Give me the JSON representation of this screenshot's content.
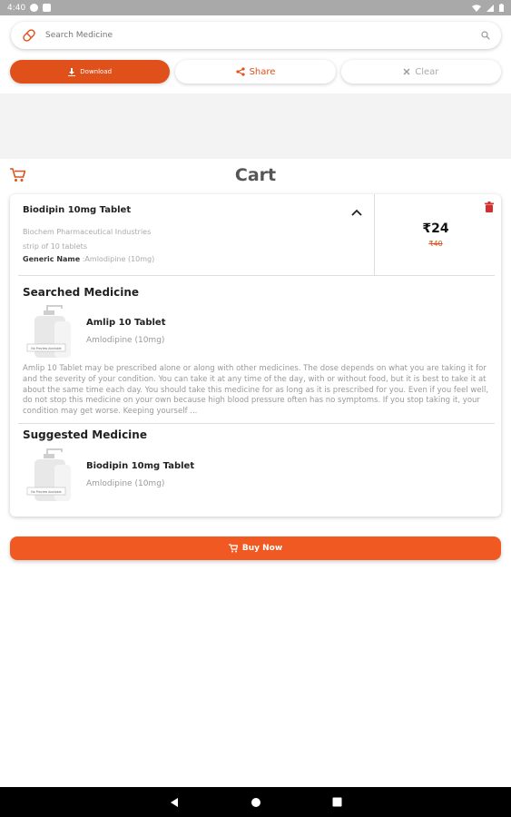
{
  "status": {
    "time": "4:40"
  },
  "search": {
    "placeholder": "Search Medicine"
  },
  "actions": {
    "download": "Download",
    "share": "Share",
    "clear": "Clear"
  },
  "cart": {
    "title": "Cart",
    "item": {
      "name": "Biodipin 10mg Tablet",
      "manufacturer": "Biochem Pharmaceutical Industries",
      "pack": "strip of 10 tablets",
      "generic_label": "Generic Name",
      "generic_value": ":Amlodipine (10mg)",
      "price": "₹24",
      "mrp": "₹40"
    },
    "searched": {
      "title": "Searched Medicine",
      "name": "Amlip 10 Tablet",
      "generic": "Amlodipine (10mg)",
      "thumb_label": "No Preview Available",
      "description": "Amlip 10 Tablet may be prescribed alone or along with other medicines. The dose depends on what you are taking it for and the severity of your condition. You can take it at any time of the day, with or without food, but it is best to take it at about the same time each day. You should take this medicine for as long as it is prescribed for you. Even if you feel well, do not stop this medicine on your own because high blood pressure often has no symptoms. If you stop taking it, your condition may get worse. Keeping yourself ..."
    },
    "suggested": {
      "title": "Suggested Medicine",
      "name": "Biodipin 10mg Tablet",
      "generic": "Amlodipine (10mg)",
      "thumb_label": "No Preview Available"
    },
    "buy_now": "Buy Now"
  },
  "colors": {
    "accent": "#e0501a",
    "buy": "#f05a22"
  },
  "icons": [
    "pill-icon",
    "search-icon",
    "download-icon",
    "share-icon",
    "close-icon",
    "cart-icon",
    "chevron-up-icon",
    "trash-icon",
    "back-icon",
    "home-icon",
    "recents-icon"
  ]
}
